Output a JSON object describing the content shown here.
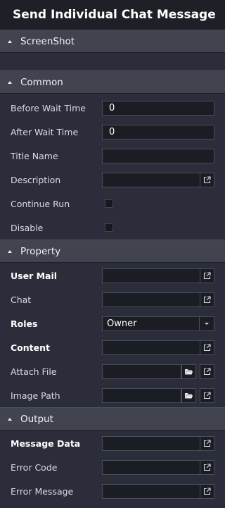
{
  "window": {
    "title": "Send Individual Chat Message"
  },
  "sections": {
    "screenshot": {
      "label": "ScreenShot"
    },
    "common": {
      "label": "Common",
      "before_wait_time": {
        "label": "Before Wait Time",
        "value": "0"
      },
      "after_wait_time": {
        "label": "After Wait Time",
        "value": "0"
      },
      "title_name": {
        "label": "Title Name",
        "value": ""
      },
      "description": {
        "label": "Description",
        "value": ""
      },
      "continue_run": {
        "label": "Continue Run",
        "checked": false
      },
      "disable": {
        "label": "Disable",
        "checked": false
      }
    },
    "property": {
      "label": "Property",
      "user_mail": {
        "label": "User Mail",
        "value": ""
      },
      "chat": {
        "label": "Chat",
        "value": ""
      },
      "roles": {
        "label": "Roles",
        "value": "Owner"
      },
      "content": {
        "label": "Content",
        "value": ""
      },
      "attach_file": {
        "label": "Attach File",
        "value": ""
      },
      "image_path": {
        "label": "Image Path",
        "value": ""
      }
    },
    "output": {
      "label": "Output",
      "message_data": {
        "label": "Message Data",
        "value": ""
      },
      "error_code": {
        "label": "Error Code",
        "value": ""
      },
      "error_message": {
        "label": "Error Message",
        "value": ""
      }
    }
  },
  "icons": {
    "expand": "external-link-icon",
    "folder": "folder-open-icon",
    "collapse": "collapse-arrow-icon",
    "dropdown": "chevron-down-icon"
  },
  "colors": {
    "background": "#2b2e3a",
    "title_bar": "#1e2027",
    "section_header": "#41444f",
    "field": "#1b1d24"
  }
}
